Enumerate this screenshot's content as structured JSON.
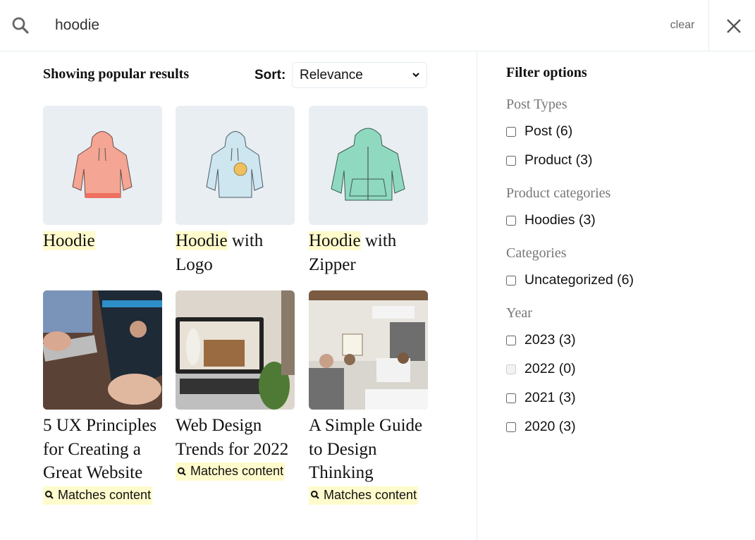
{
  "search": {
    "query": "hoodie",
    "clear_label": "clear",
    "search_icon": "search-icon",
    "close_icon": "close-icon"
  },
  "results": {
    "heading": "Showing popular results",
    "sort_label": "Sort:",
    "sort_value": "Relevance",
    "highlight_color": "#fffbcc",
    "items": [
      {
        "title_highlight": "Hoodie",
        "title_rest": "",
        "thumb": "orange-hoodie-image",
        "color": "#f4a593",
        "match_badge": null
      },
      {
        "title_highlight": "Hoodie",
        "title_rest": " with Logo",
        "thumb": "blue-hoodie-with-logo-image",
        "color": "#c9e3ee",
        "match_badge": null
      },
      {
        "title_highlight": "Hoodie",
        "title_rest": " with Zipper",
        "thumb": "green-zip-hoodie-image",
        "color": "#8fd9c0",
        "match_badge": null
      },
      {
        "title_highlight": "",
        "title_rest": "5 UX Principles for Creating a Great Website",
        "thumb": "laptop-website-photo",
        "match_badge": "Matches content"
      },
      {
        "title_highlight": "",
        "title_rest": "Web Design Trends for 2022",
        "thumb": "laptop-desk-photo",
        "match_badge": "Matches content"
      },
      {
        "title_highlight": "",
        "title_rest": "A Simple Guide to Design Thinking",
        "thumb": "office-team-photo",
        "match_badge": "Matches content"
      }
    ]
  },
  "filters": {
    "title": "Filter options",
    "groups": [
      {
        "label": "Post Types",
        "options": [
          {
            "label": "Post (6)",
            "checked": false,
            "disabled": false
          },
          {
            "label": "Product (3)",
            "checked": false,
            "disabled": false
          }
        ]
      },
      {
        "label": "Product categories",
        "options": [
          {
            "label": "Hoodies (3)",
            "checked": false,
            "disabled": false
          }
        ]
      },
      {
        "label": "Categories",
        "options": [
          {
            "label": "Uncategorized (6)",
            "checked": false,
            "disabled": false
          }
        ]
      },
      {
        "label": "Year",
        "options": [
          {
            "label": "2023 (3)",
            "checked": false,
            "disabled": false
          },
          {
            "label": "2022 (0)",
            "checked": false,
            "disabled": true
          },
          {
            "label": "2021 (3)",
            "checked": false,
            "disabled": false
          },
          {
            "label": "2020 (3)",
            "checked": false,
            "disabled": false
          }
        ]
      }
    ]
  }
}
